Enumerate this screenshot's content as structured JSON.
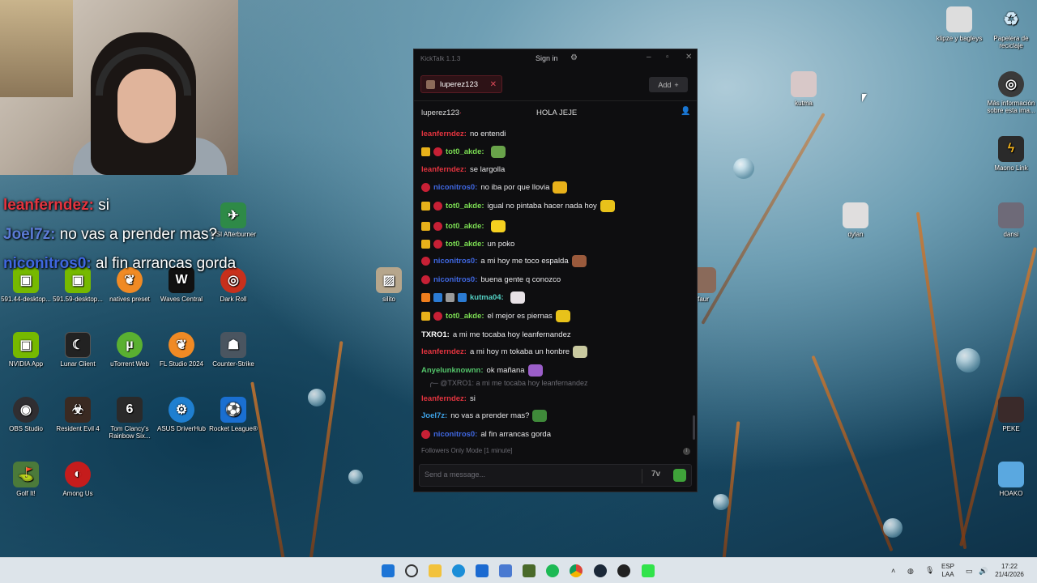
{
  "overlay_chat": [
    {
      "user": "leanferndez:",
      "text": " si",
      "color": "#e4343f"
    },
    {
      "user": "Joel7z:",
      "text": " no vas a prender mas?",
      "color": "#5b7bd6"
    },
    {
      "user": "niconitros0:",
      "text": " al fin arrancas gorda",
      "color": "#3f67e0"
    }
  ],
  "desktop_icons": {
    "msi": "MSI Afterburner",
    "silito": "silito",
    "nvidia": "NVIDIA App",
    "lunar": "Lunar Client",
    "utorrent": "uTorrent Web",
    "flstudio": "FL Studio 2024",
    "cs": "Counter-Strike",
    "obs": "OBS Studio",
    "re4": "Resident Evil 4",
    "rainbow": "Tom Clancy's Rainbow Six...",
    "asus": "ASUS DriverHub",
    "rocket": "Rocket League®",
    "golf": "Golf It!",
    "among": "Among Us",
    "waves": "Waves Central",
    "dark": "Dark Roll",
    "natives": "natives preset",
    "desk1": "591.44-desktop...",
    "desk2": "591.59-desktop...",
    "kutma": "kutma",
    "dylan": "dylan",
    "dansi": "dansi",
    "klipze": "klipze y bagleys",
    "recycle": "Papelera de reciclaje",
    "info": "Más información sobre esta ima...",
    "maono": "Maono Link",
    "peke": "PEKE",
    "faur": "faur",
    "hoako": "HOAKO"
  },
  "window": {
    "app_title": "KickTalk 1.1.3",
    "sign_in": "Sign in",
    "tab_channel": "luperez123",
    "add_label": "Add",
    "channel_name": "luperez123",
    "stream_title": "HOLA JEJE",
    "followers_mode": "Followers Only Mode [1 minute]",
    "input_placeholder": "Send a message..."
  },
  "messages": [
    {
      "user": "leanferndez:",
      "text": "no entendi",
      "color": "#e4343f",
      "badges": []
    },
    {
      "user": "tot0_akde:",
      "text": "",
      "color": "#7cde53",
      "badges": [
        "crown",
        "red"
      ],
      "emote": "#69a34a"
    },
    {
      "user": "leanferndez:",
      "text": "se largolla",
      "color": "#e4343f",
      "badges": []
    },
    {
      "user": "niconitros0:",
      "text": "no iba por que llovia",
      "color": "#3f67e0",
      "badges": [
        "red"
      ],
      "emote": "#e8b11a"
    },
    {
      "user": "tot0_akde:",
      "text": "igual no pintaba hacer nada hoy",
      "color": "#7cde53",
      "badges": [
        "crown",
        "red"
      ],
      "emote": "#e8c21a"
    },
    {
      "user": "tot0_akde:",
      "text": "",
      "color": "#7cde53",
      "badges": [
        "crown",
        "red"
      ],
      "emote": "#f5d020"
    },
    {
      "user": "tot0_akde:",
      "text": "un poko",
      "color": "#7cde53",
      "badges": [
        "crown",
        "red"
      ]
    },
    {
      "user": "niconitros0:",
      "text": "a mi hoy me toco espalda",
      "color": "#3f67e0",
      "badges": [
        "red"
      ],
      "emote": "#9a5a3c"
    },
    {
      "user": "niconitros0:",
      "text": "buena gente q conozco",
      "color": "#3f67e0",
      "badges": [
        "red"
      ]
    },
    {
      "user": "kutma04:",
      "text": "",
      "color": "#53d0c3",
      "badges": [
        "orange",
        "blue",
        "gray",
        "blue"
      ],
      "emote": "#e8e2e6"
    },
    {
      "user": "tot0_akde:",
      "text": "el mejor es piernas",
      "color": "#7cde53",
      "badges": [
        "crown",
        "red"
      ],
      "emote": "#e8c21a"
    },
    {
      "user": "TXRO1:",
      "text": "a mi me tocaba hoy leanfernandez",
      "color": "#ffffff",
      "badges": []
    },
    {
      "user": "leanferndez:",
      "text": "a mi hoy m tokaba un honbre",
      "color": "#e4343f",
      "badges": [],
      "emote": "#c9c9a0"
    },
    {
      "user": "Anyelunknownn:",
      "text": "ok mañana",
      "color": "#53c46a",
      "badges": [],
      "emote": "#9b5ec9"
    },
    {
      "user": "leanferndez:",
      "text": "si",
      "color": "#e4343f",
      "badges": []
    },
    {
      "user": "Joel7z:",
      "text": "no vas a prender mas?",
      "color": "#3fa3e8",
      "badges": [],
      "emote": "#3f8a3a"
    },
    {
      "user": "niconitros0:",
      "text": "al fin arrancas gorda",
      "color": "#3f67e0",
      "badges": [
        "red"
      ]
    }
  ],
  "reply": {
    "mention": "@TXRO1:",
    "text": "a mi me tocaba hoy leanfernandez"
  },
  "taskbar": {
    "lang1": "ESP",
    "lang2": "LAA",
    "time": "17:22",
    "date": "21/4/2026"
  }
}
